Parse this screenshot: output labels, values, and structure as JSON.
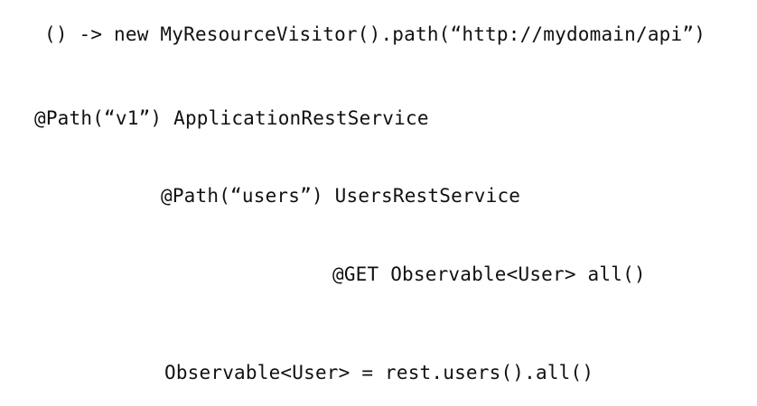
{
  "lines": [
    "() -> new MyResourceVisitor().path(“http://mydomain/api”)",
    "@Path(“v1”) ApplicationRestService",
    "@Path(“users”) UsersRestService",
    "@GET Observable<User> all()",
    "Observable<User> = rest.users().all()"
  ]
}
